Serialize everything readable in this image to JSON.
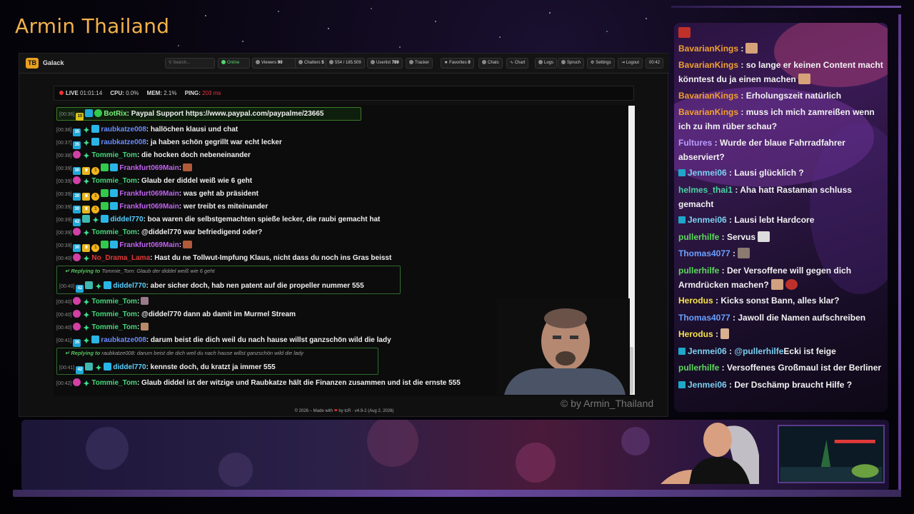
{
  "overlay": {
    "title": "Armin Thailand",
    "watermark": "© by Armin_Thailand"
  },
  "navbar": {
    "logo": "TB",
    "brand": "Galack",
    "search_placeholder": "Search...",
    "online": "Online",
    "viewers_label": "Viewers",
    "viewers": "90",
    "chatters_label": "Chatters",
    "chatters": "5",
    "messages": "554 / 185.509",
    "userlist_label": "Userlist",
    "userlist": "789",
    "tracker": "Tracker",
    "favorites_label": "Favorites",
    "favorites": "0",
    "chats": "Chats",
    "chart": "Chart",
    "logs": "Logs",
    "spruch": "Spruch",
    "settings": "Settings",
    "logout": "Logout",
    "clock": "00:42"
  },
  "status": {
    "live_label": "LIVE",
    "live": "01:01:14",
    "cpu_label": "CPU:",
    "cpu": "0.0%",
    "mem_label": "MEM:",
    "mem": "2.1%",
    "ping_label": "PING:",
    "ping": "203 ms"
  },
  "chat": [
    {
      "ts": "[00:36]",
      "user": "BotRix",
      "text": ": Paypal Support https://www.paypal.com/paypalme/23665"
    },
    {
      "ts": "[00:36]",
      "user": "raubkatze008",
      "text": ": hallöchen klausi und chat"
    },
    {
      "ts": "[00:37]",
      "user": "raubkatze008",
      "text": ": ja haben schön gegrillt war echt lecker"
    },
    {
      "ts": "[00:38]",
      "user": "Tommie_Tom",
      "text": ": die hocken doch nebeneinander"
    },
    {
      "ts": "[00:39]",
      "user": "Frankfurt069Main",
      "text": ":"
    },
    {
      "ts": "[00:39]",
      "user": "Tommie_Tom",
      "text": ": Glaub der diddel weiß wie 6 geht"
    },
    {
      "ts": "[00:39]",
      "user": "Frankfurt069Main",
      "text": ": was geht ab präsident"
    },
    {
      "ts": "[00:39]",
      "user": "Frankfurt069Main",
      "text": ": wer treibt es miteinander"
    },
    {
      "ts": "[00:39]",
      "user": "diddel770",
      "text": ": boa waren die selbstgemachten spieße lecker, die raubi gemacht hat"
    },
    {
      "ts": "[00:39]",
      "user": "Tommie_Tom",
      "text": ": @diddel770 war befriedigend oder?"
    },
    {
      "ts": "[00:39]",
      "user": "Frankfurt069Main",
      "text": ":"
    },
    {
      "ts": "[00:40]",
      "user": "No_Drama_Lama",
      "text": ": Hast du ne Tollwut-Impfung Klaus, nicht dass du noch ins Gras beisst"
    },
    {
      "ts": "[00:40]",
      "user": "diddel770",
      "text": ": aber sicher doch, hab nen patent auf die propeller nummer 555",
      "reply_label": "Replying to",
      "reply": "Tommie_Tom: Glaub der diddel weiß wie 6 geht"
    },
    {
      "ts": "[00:40]",
      "user": "Tommie_Tom",
      "text": ":"
    },
    {
      "ts": "[00:40]",
      "user": "Tommie_Tom",
      "text": ": @diddel770 dann ab damit im Murmel Stream"
    },
    {
      "ts": "[00:40]",
      "user": "Tommie_Tom",
      "text": ":"
    },
    {
      "ts": "[00:41]",
      "user": "raubkatze008",
      "text": ": darum beist die dich weil du nach hause willst ganzschön wild die lady"
    },
    {
      "ts": "[00:41]",
      "user": "diddel770",
      "text": ": kennste doch, du kratzt ja immer 555",
      "reply_label": "Replying to",
      "reply": "raubkatze008: darum beist die dich weil du nach hause willst ganzschön wild die lady"
    },
    {
      "ts": "[00:42]",
      "user": "Tommie_Tom",
      "text": ": Glaub diddel ist der witzige und Raubkatze hält die Finanzen zusammen und ist die ernste 555"
    }
  ],
  "footer": {
    "prefix": "© 2026 – Made with",
    "suffix": "by tcR · v4.9-2 (Aug 2, 2026)"
  },
  "right_chat": [
    {
      "user": "BavarianKings",
      "text": " :"
    },
    {
      "user": "BavarianKings",
      "text": " : so lange er keinen Content macht könntest du ja einen machen"
    },
    {
      "user": "BavarianKings",
      "text": " : Erholungszeit natürlich"
    },
    {
      "user": "BavarianKings",
      "text": " : muss ich mich zamreißen wenn ich zu ihm rüber schau?"
    },
    {
      "user": "Fultures",
      "text": " : Wurde der blaue Fahrradfahrer abserviert?"
    },
    {
      "user": "Jenmei06",
      "text": " : Lausi glücklich ?"
    },
    {
      "user": "helmes_thai1",
      "text": " : Aha hatt Rastaman schluss gemacht"
    },
    {
      "user": "Jenmei06",
      "text": " : Lausi lebt Hardcore"
    },
    {
      "user": "pullerhilfe",
      "text": " : Servus"
    },
    {
      "user": "Thomas4077",
      "text": " :"
    },
    {
      "user": "pullerhilfe",
      "text": " : Der Versoffene will gegen dich Armdrücken machen?"
    },
    {
      "user": "Herodus",
      "text": " : Kicks sonst Bann, alles klar?"
    },
    {
      "user": "Thomas4077",
      "text": " : Jawoll die Namen aufschreiben"
    },
    {
      "user": "Herodus",
      "text": " :"
    },
    {
      "user": "Jenmei06",
      "text": " : ",
      "mention": "@pullerhilfe",
      "text2": "Ecki ist feige"
    },
    {
      "user": "pullerhilfe",
      "text": " : Versoffenes Großmaul ist der Berliner"
    },
    {
      "user": "Jenmei06",
      "text": " : Der Dschämp braucht Hilfe ?"
    }
  ],
  "colors": {
    "bavarian": "#f0a030",
    "jenmei": "#7ad0f0",
    "puller": "#5ed85e",
    "fultures": "#b99cff",
    "thomas": "#6aa0ff",
    "herodus": "#f7e34a",
    "helmes": "#4ad3a0",
    "tommie": "#45d87a",
    "raubkatze": "#6a8cff",
    "frankfurt": "#c063f0",
    "diddel": "#5ad0ff",
    "botrix": "#7cf07c",
    "nodrama": "#e23a3a"
  }
}
